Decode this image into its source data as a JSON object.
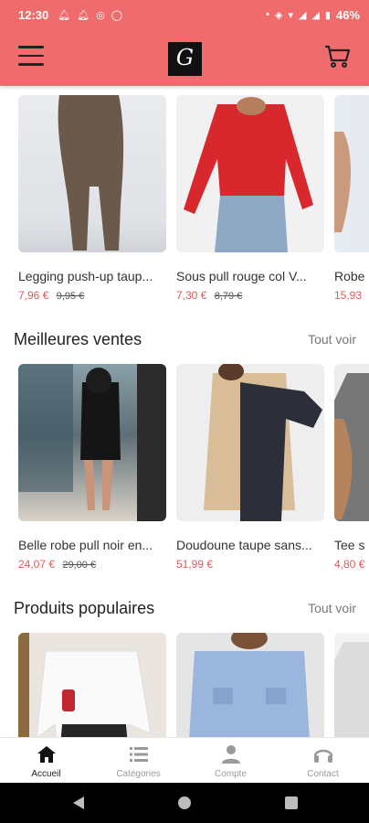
{
  "status_bar": {
    "time": "12:30",
    "battery": "46%"
  },
  "app_bar": {
    "logo_letter": "G"
  },
  "sections": [
    {
      "title": "",
      "see_all": ""
    },
    {
      "title": "Meilleures ventes",
      "see_all": "Tout voir"
    },
    {
      "title": "Produits populaires",
      "see_all": "Tout voir"
    }
  ],
  "rows": [
    [
      {
        "name": "Legging push-up taup...",
        "price": "7,96 €",
        "old_price": "9,95 €"
      },
      {
        "name": "Sous pull rouge col V...",
        "price": "7,30 €",
        "old_price": "8,79 €"
      },
      {
        "name": "Robe",
        "price": "15,93",
        "old_price": ""
      }
    ],
    [
      {
        "name": "Belle robe pull noir en...",
        "price": "24,07 €",
        "old_price": "29,00 €"
      },
      {
        "name": "Doudoune taupe sans...",
        "price": "51,99 €",
        "old_price": ""
      },
      {
        "name": "Tee s",
        "price": "4,80 €",
        "old_price": ""
      }
    ],
    [
      {
        "name": "",
        "price": "",
        "old_price": ""
      },
      {
        "name": "",
        "price": "",
        "old_price": ""
      },
      {
        "name": "",
        "price": "",
        "old_price": ""
      }
    ]
  ],
  "bottom_nav": [
    {
      "label": "Accueil",
      "icon": "home-icon",
      "active": true
    },
    {
      "label": "Catégories",
      "icon": "list-icon",
      "active": false
    },
    {
      "label": "Compte",
      "icon": "person-icon",
      "active": false
    },
    {
      "label": "Contact",
      "icon": "headset-icon",
      "active": false
    }
  ],
  "colors": {
    "brand": "#f06c6c",
    "price": "#e05a5a"
  }
}
